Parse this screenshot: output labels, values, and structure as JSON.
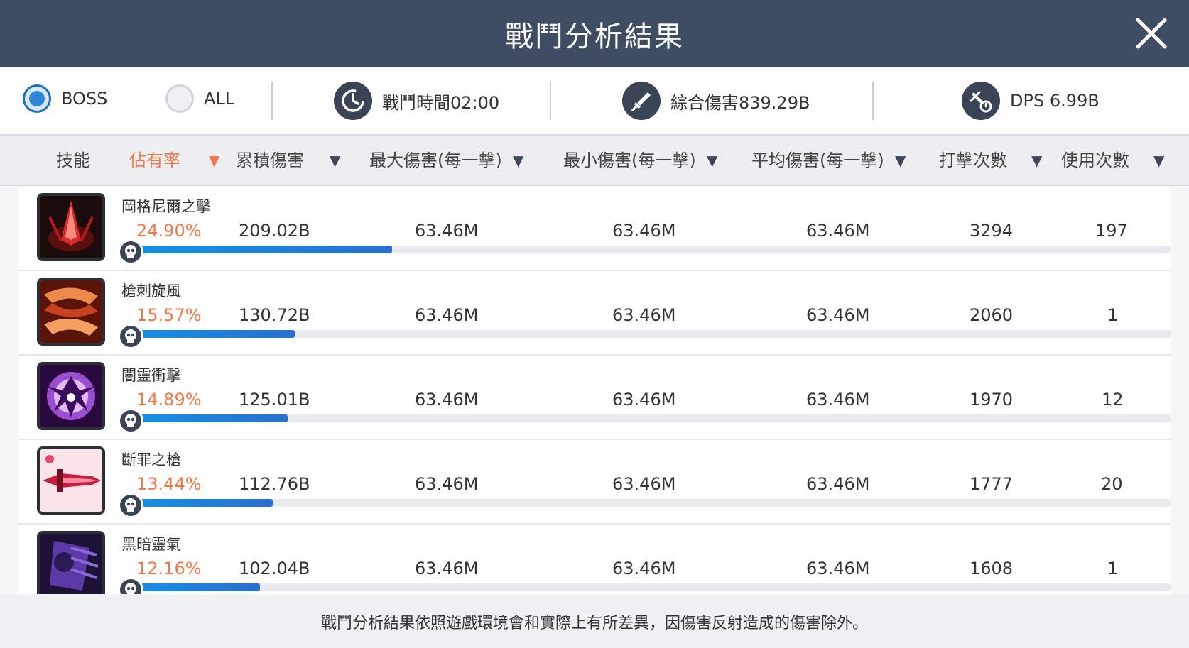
{
  "window": {
    "title": "戰鬥分析結果"
  },
  "filters": [
    {
      "label": "BOSS",
      "selected": true
    },
    {
      "label": "ALL",
      "selected": false
    }
  ],
  "summary": {
    "battle_time": "戰鬥時間02:00",
    "total_damage": "綜合傷害839.29B",
    "dps": "DPS 6.99B"
  },
  "columns": [
    {
      "label": "技能"
    },
    {
      "label": "佔有率",
      "active": true
    },
    {
      "label": "累積傷害"
    },
    {
      "label": "最大傷害(每一擊)"
    },
    {
      "label": "最小傷害(每一擊)"
    },
    {
      "label": "平均傷害(每一擊)"
    },
    {
      "label": "打擊次數"
    },
    {
      "label": "使用次數"
    }
  ],
  "sort_arrow": "▼",
  "skills": [
    {
      "name": "岡格尼爾之擊",
      "share": "24.90%",
      "share_value": 0.249,
      "total": "209.02B",
      "max": "63.46M",
      "min": "63.46M",
      "avg": "63.46M",
      "hits": "3294",
      "uses": "197",
      "icon": "red-spear-strike-icon"
    },
    {
      "name": "槍刺旋風",
      "share": "15.57%",
      "share_value": 0.1557,
      "total": "130.72B",
      "max": "63.46M",
      "min": "63.46M",
      "avg": "63.46M",
      "hits": "2060",
      "uses": "1",
      "icon": "orange-whirlwind-icon"
    },
    {
      "name": "闇靈衝擊",
      "share": "14.89%",
      "share_value": 0.1489,
      "total": "125.01B",
      "max": "63.46M",
      "min": "63.46M",
      "avg": "63.46M",
      "hits": "1970",
      "uses": "12",
      "icon": "purple-dark-spirit-icon"
    },
    {
      "name": "斷罪之槍",
      "share": "13.44%",
      "share_value": 0.1344,
      "total": "112.76B",
      "max": "63.46M",
      "min": "63.46M",
      "avg": "63.46M",
      "hits": "1777",
      "uses": "20",
      "icon": "pink-lance-icon"
    },
    {
      "name": "黑暗靈氣",
      "share": "12.16%",
      "share_value": 0.1216,
      "total": "102.04B",
      "max": "63.46M",
      "min": "63.46M",
      "avg": "63.46M",
      "hits": "1608",
      "uses": "1",
      "icon": "dark-aura-icon"
    }
  ],
  "colors": {
    "header_bg": "#3f4d63",
    "accent_orange": "#ef7a4b",
    "bar_blue": "#1591e6",
    "radio_blue": "#2e86d6"
  },
  "footer": {
    "note": "戰鬥分析結果依照遊戲環境會和實際上有所差異，因傷害反射造成的傷害除外。"
  }
}
